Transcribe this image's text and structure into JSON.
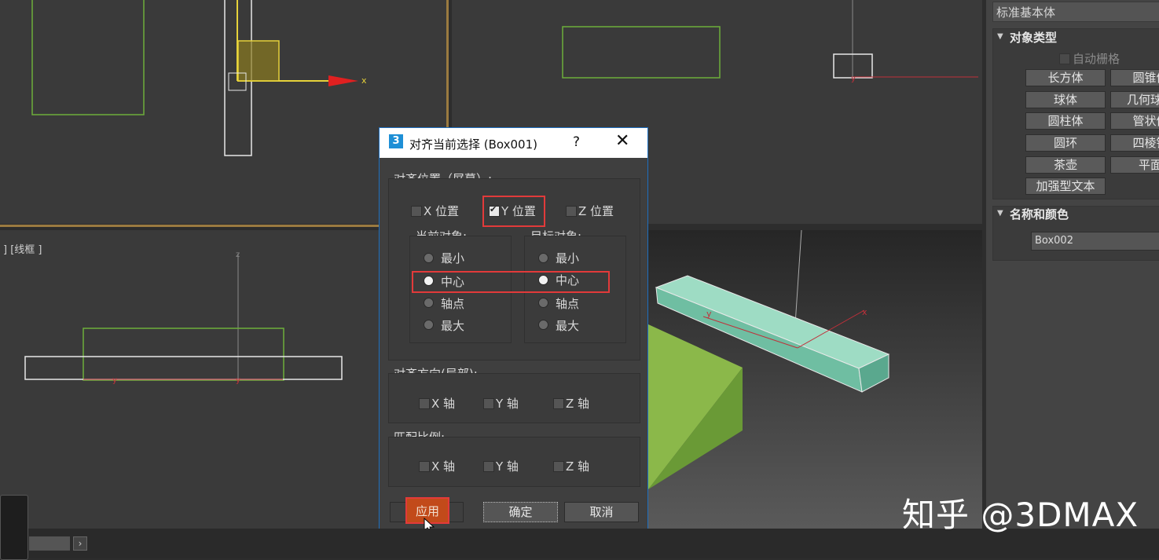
{
  "viewports": {
    "bottom_left_label": "] [线框 ]"
  },
  "command_panel": {
    "dropdown": "标准基本体",
    "object_type": {
      "title": "对象类型",
      "autogrid": "自动栅格",
      "buttons": [
        "长方体",
        "圆锥体",
        "球体",
        "几何球体",
        "圆柱体",
        "管状体",
        "圆环",
        "四棱锥",
        "茶壶",
        "平面",
        "加强型文本"
      ]
    },
    "name_color": {
      "title": "名称和颜色",
      "name_value": "Box002"
    }
  },
  "dialog": {
    "title": "对齐当前选择 (Box001)",
    "help": "?",
    "close": "✕",
    "align_position": {
      "title": "对齐位置（屏幕）:",
      "x": "X 位置",
      "y": "Y 位置",
      "z": "Z 位置",
      "x_checked": false,
      "y_checked": true,
      "z_checked": false
    },
    "current_object": {
      "title": "当前对象:",
      "options": [
        "最小",
        "中心",
        "轴点",
        "最大"
      ],
      "selected": "中心"
    },
    "target_object": {
      "title": "目标对象:",
      "options": [
        "最小",
        "中心",
        "轴点",
        "最大"
      ],
      "selected": "中心"
    },
    "align_orientation": {
      "title": "对齐方向(局部):",
      "x": "X 轴",
      "y": "Y 轴",
      "z": "Z 轴"
    },
    "match_scale": {
      "title": "匹配比例:",
      "x": "X 轴",
      "y": "Y 轴",
      "z": "Z 轴"
    },
    "buttons": {
      "apply": "应用",
      "ok": "确定",
      "cancel": "取消"
    }
  },
  "watermark": "知乎 @3DMAX",
  "colors": {
    "highlight": "#e23a3a",
    "gizmo_yellow": "#e6d23a",
    "box_green": "#8bb84a",
    "beam": "#7fc9b0"
  }
}
